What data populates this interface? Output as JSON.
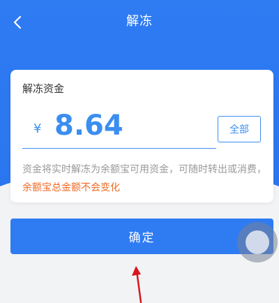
{
  "nav": {
    "title": "解冻"
  },
  "card": {
    "label": "解冻资金",
    "currency_symbol": "¥",
    "amount_value": "8.64",
    "all_button_label": "全部",
    "note_plain": "资金将实时解冻为余额宝可用资金，可随时转出或消费，",
    "note_highlight": "余额宝总金额不会变化"
  },
  "actions": {
    "confirm_label": "确定"
  },
  "colors": {
    "brand_blue": "#2f7bf2",
    "amount_blue": "#3b8ef0",
    "highlight_orange": "#ee6b25",
    "annotation_red": "#d9141e"
  },
  "icons": {
    "back": "chevron-left-icon",
    "floating": "assistive-touch-icon",
    "annotation": "red-arrow-icon"
  }
}
